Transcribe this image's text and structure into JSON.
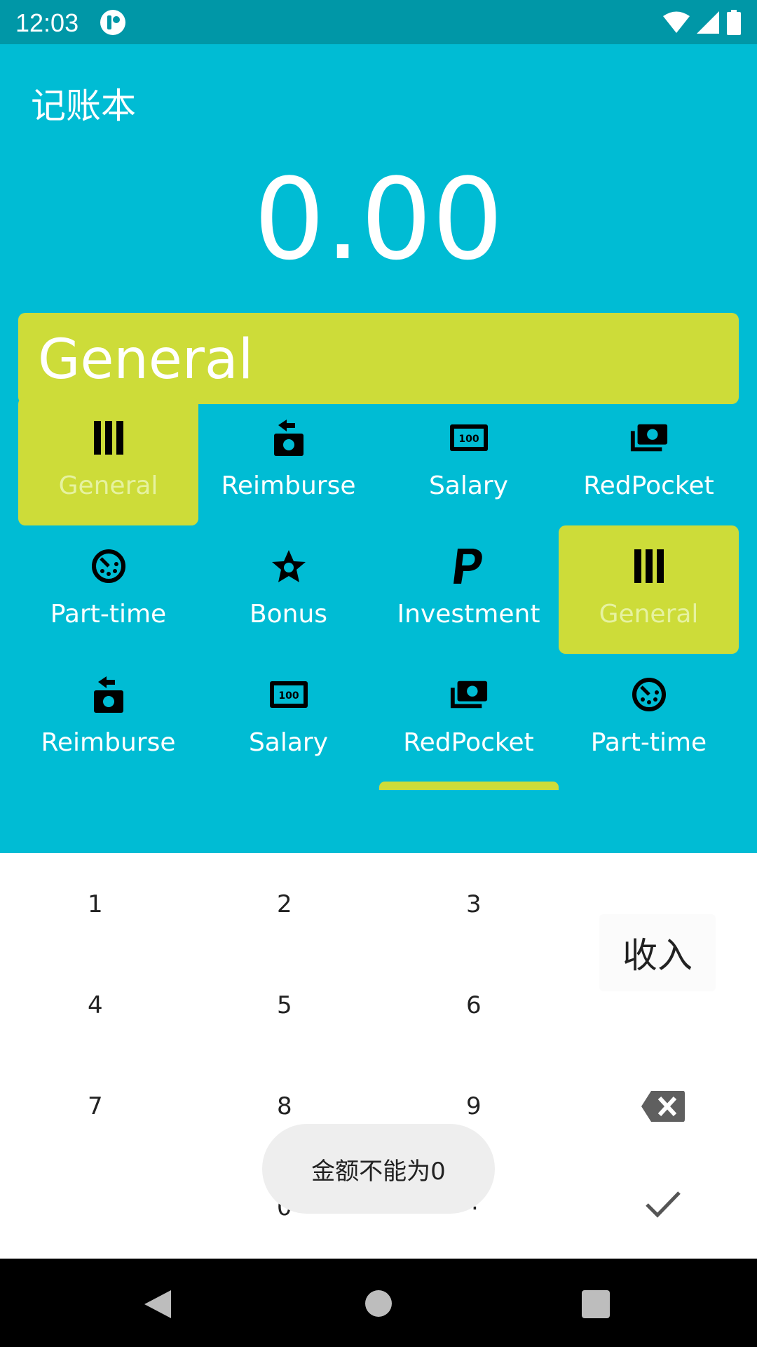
{
  "status_bar": {
    "time": "12:03"
  },
  "app": {
    "title": "记账本"
  },
  "amount": "0.00",
  "selected_category": "General",
  "categories": [
    {
      "label": "General",
      "icon": "bars-icon",
      "selected": true
    },
    {
      "label": "Reimburse",
      "icon": "money-return-icon",
      "selected": false
    },
    {
      "label": "Salary",
      "icon": "banknote-100-icon",
      "selected": false
    },
    {
      "label": "RedPocket",
      "icon": "money-stack-icon",
      "selected": false
    },
    {
      "label": "Part-time",
      "icon": "clock-icon",
      "selected": false
    },
    {
      "label": "Bonus",
      "icon": "star-badge-icon",
      "selected": false
    },
    {
      "label": "Investment",
      "icon": "paypal-icon",
      "selected": false
    },
    {
      "label": "General",
      "icon": "bars-icon",
      "selected": true
    },
    {
      "label": "Reimburse",
      "icon": "money-return-icon",
      "selected": false
    },
    {
      "label": "Salary",
      "icon": "banknote-100-icon",
      "selected": false
    },
    {
      "label": "RedPocket",
      "icon": "money-stack-icon",
      "selected": false
    },
    {
      "label": "Part-time",
      "icon": "clock-icon",
      "selected": false
    }
  ],
  "keypad": {
    "keys": [
      "1",
      "2",
      "3",
      "4",
      "5",
      "6",
      "7",
      "8",
      "9",
      "0",
      "."
    ],
    "type_button": "收入",
    "backspace_icon": "backspace-icon",
    "confirm_icon": "check-icon"
  },
  "toast": "金额不能为0",
  "nav": {
    "back_icon": "back-icon",
    "home_icon": "home-icon",
    "recent_icon": "recents-icon"
  },
  "colors": {
    "primary": "#00BCD4",
    "primary_dark": "#0097A7",
    "accent": "#CDDC39"
  }
}
